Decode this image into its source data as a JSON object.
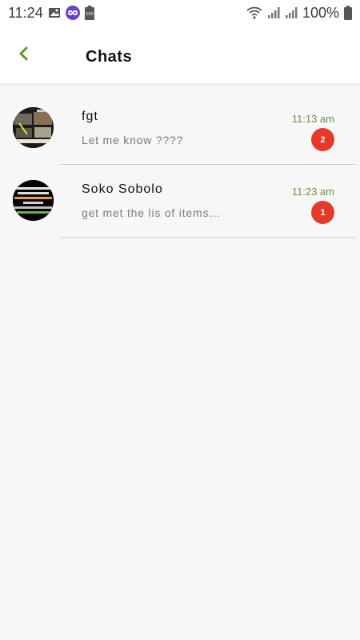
{
  "status_bar": {
    "time": "11:24",
    "battery_percent": "100%",
    "icons": [
      "image-icon",
      "sync-app-icon",
      "battery-saver-icon",
      "wifi-icon",
      "signal-icon",
      "signal-icon-2",
      "battery-icon"
    ],
    "sb_badge": "100"
  },
  "header": {
    "title": "Chats",
    "back_icon": "chevron-left-icon",
    "accent_color": "#5a9e1a"
  },
  "chats": [
    {
      "name": "fgt",
      "preview": "Let me know ????",
      "time": "11:13 am",
      "unread": "2",
      "avatar": "collage-avatar"
    },
    {
      "name": "Soko Sobolo",
      "preview": "get met the lis of items…",
      "time": "11:23 am",
      "unread": "1",
      "avatar": "text-poster-avatar"
    }
  ],
  "colors": {
    "badge": "#e53a2a",
    "time": "#6f8f4a",
    "background": "#f7f7f7"
  }
}
